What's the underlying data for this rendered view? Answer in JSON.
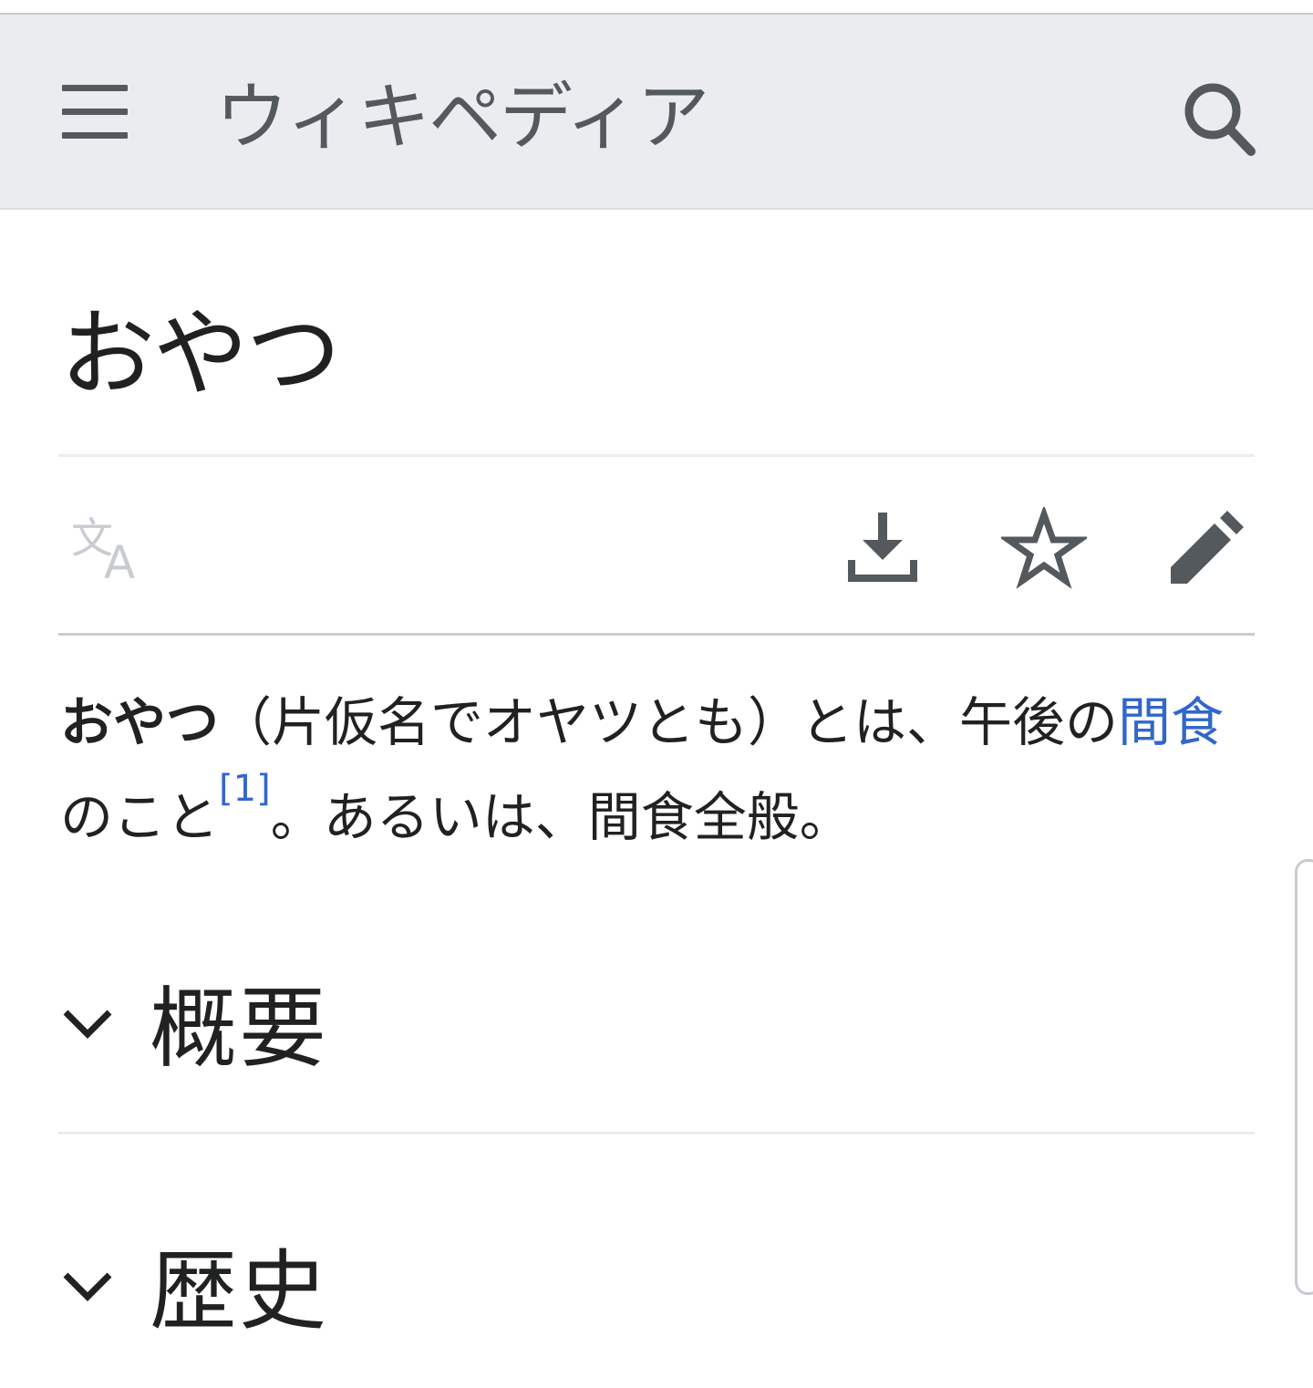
{
  "header": {
    "wordmark": "ウィキペディア",
    "menu_icon": "hamburger-menu-icon",
    "search_icon": "search-icon"
  },
  "article": {
    "title": "おやつ",
    "lead": {
      "bold_term": "おやつ",
      "part1": "（片仮名でオヤツとも）とは、午後の",
      "link_text": "間食",
      "part2": "のこと",
      "ref": "[1]",
      "part3": "。あるいは、間食全般。"
    }
  },
  "toolbar": {
    "language_icon": "language-icon",
    "download_icon": "download-icon",
    "watch_icon": "star-icon",
    "edit_icon": "pencil-icon"
  },
  "sections": [
    {
      "title": "概要",
      "icon": "chevron-down-icon"
    },
    {
      "title": "歴史",
      "icon": "chevron-down-icon"
    }
  ],
  "colors": {
    "header_bg": "#eaecf0",
    "link": "#3366cc",
    "icon": "#54595d",
    "text": "#202122",
    "disabled_icon": "#c8ccd1"
  }
}
